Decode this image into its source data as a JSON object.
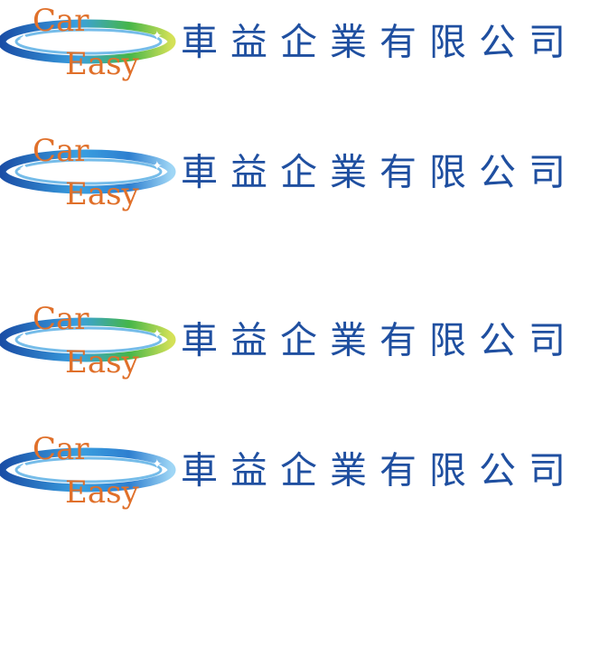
{
  "brand": {
    "word_top": "Car",
    "word_bottom": "Easy",
    "company_name": "車益企業有限公司"
  },
  "variants": [
    {
      "ring_colors": [
        "#1a4ea6",
        "#3aa0e0",
        "#45b649",
        "#d4e157"
      ]
    },
    {
      "ring_colors": [
        "#1a4ea6",
        "#3aa0e0",
        "#2e7fd0",
        "#9fd6f5"
      ]
    },
    {
      "ring_colors": [
        "#1a4ea6",
        "#3aa0e0",
        "#45b649",
        "#d4e157"
      ]
    },
    {
      "ring_colors": [
        "#1a4ea6",
        "#3aa0e0",
        "#2e7fd0",
        "#9fd6f5"
      ]
    }
  ],
  "colors": {
    "company_text": "#1f4fa0",
    "logo_text": "#e0702a"
  }
}
